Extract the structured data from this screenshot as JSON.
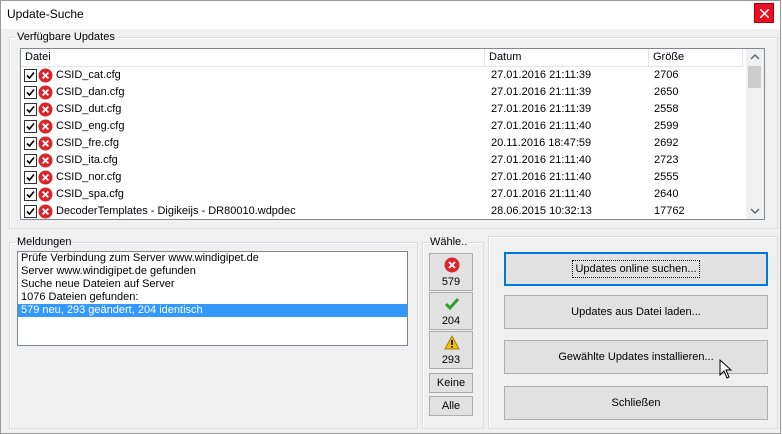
{
  "window": {
    "title": "Update-Suche"
  },
  "updates": {
    "group_label": "Verfügbare Updates",
    "columns": [
      "Datei",
      "Datum",
      "Größe"
    ],
    "rows": [
      {
        "name": "CSID_cat.cfg",
        "date": "27.01.2016 21:11:39",
        "size": "2706"
      },
      {
        "name": "CSID_dan.cfg",
        "date": "27.01.2016 21:11:39",
        "size": "2650"
      },
      {
        "name": "CSID_dut.cfg",
        "date": "27.01.2016 21:11:39",
        "size": "2558"
      },
      {
        "name": "CSID_eng.cfg",
        "date": "27.01.2016 21:11:40",
        "size": "2599"
      },
      {
        "name": "CSID_fre.cfg",
        "date": "20.11.2016 18:47:59",
        "size": "2692"
      },
      {
        "name": "CSID_ita.cfg",
        "date": "27.01.2016 21:11:40",
        "size": "2723"
      },
      {
        "name": "CSID_nor.cfg",
        "date": "27.01.2016 21:11:40",
        "size": "2555"
      },
      {
        "name": "CSID_spa.cfg",
        "date": "27.01.2016 21:11:40",
        "size": "2640"
      },
      {
        "name": "DecoderTemplates - Digikeijs - DR80010.wdpdec",
        "date": "28.06.2015 10:32:13",
        "size": "17762"
      }
    ]
  },
  "messages": {
    "group_label": "Meldungen",
    "lines": [
      "Prüfe Verbindung zum Server www.windigipet.de",
      "Server www.windigipet.de gefunden",
      "Suche neue Dateien auf Server",
      "1076 Dateien gefunden:",
      "579 neu, 293 geändert, 204 identisch"
    ]
  },
  "select": {
    "group_label": "Wähle..",
    "new_count": "579",
    "changed_count": "204",
    "identical_count": "293",
    "none_label": "Keine",
    "all_label": "Alle"
  },
  "actions": {
    "search_online": "Updates online suchen...",
    "load_from_file": "Updates aus Datei laden...",
    "install_selected": "Gewählte Updates installieren...",
    "close": "Schließen"
  },
  "colors": {
    "error_red": "#d9262c",
    "ok_green": "#2e9e2e",
    "warn_yellow": "#f3c300",
    "selection": "#3399ff"
  }
}
